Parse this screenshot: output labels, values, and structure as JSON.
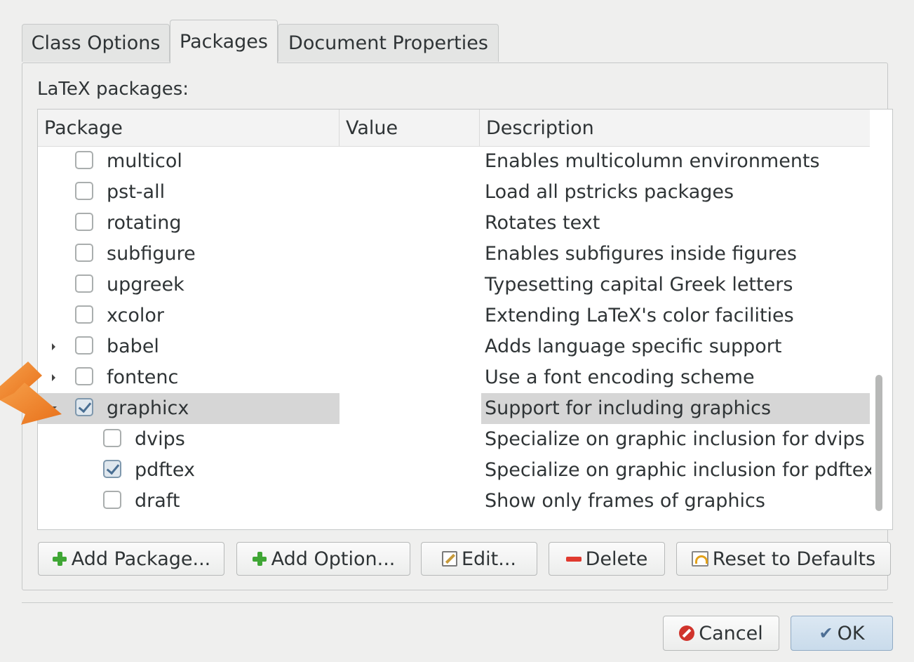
{
  "tabs": [
    {
      "label": "Class Options",
      "active": false
    },
    {
      "label": "Packages",
      "active": true
    },
    {
      "label": "Document Properties",
      "active": false
    }
  ],
  "section_label": "LaTeX packages:",
  "columns": [
    "Package",
    "Value",
    "Description"
  ],
  "rows": [
    {
      "name": "multicol",
      "value": "",
      "description": "Enables multicolumn environments",
      "checked": false,
      "level": 0,
      "expander": "none"
    },
    {
      "name": "pst-all",
      "value": "",
      "description": "Load all pstricks packages",
      "checked": false,
      "level": 0,
      "expander": "none"
    },
    {
      "name": "rotating",
      "value": "",
      "description": "Rotates text",
      "checked": false,
      "level": 0,
      "expander": "none"
    },
    {
      "name": "subfigure",
      "value": "",
      "description": "Enables subfigures inside figures",
      "checked": false,
      "level": 0,
      "expander": "none"
    },
    {
      "name": "upgreek",
      "value": "",
      "description": "Typesetting capital Greek letters",
      "checked": false,
      "level": 0,
      "expander": "none"
    },
    {
      "name": "xcolor",
      "value": "",
      "description": "Extending LaTeX's color facilities",
      "checked": false,
      "level": 0,
      "expander": "none"
    },
    {
      "name": "babel",
      "value": "",
      "description": "Adds language specific support",
      "checked": false,
      "level": 0,
      "expander": "collapsed"
    },
    {
      "name": "fontenc",
      "value": "",
      "description": "Use a font encoding scheme",
      "checked": false,
      "level": 0,
      "expander": "collapsed"
    },
    {
      "name": "graphicx",
      "value": "",
      "description": "Support for including graphics",
      "checked": true,
      "level": 0,
      "expander": "expanded",
      "selected": true
    },
    {
      "name": "dvips",
      "value": "",
      "description": "Specialize on graphic inclusion for dvips",
      "checked": false,
      "level": 1,
      "expander": "none"
    },
    {
      "name": "pdftex",
      "value": "",
      "description": "Specialize on graphic inclusion for pdftex",
      "checked": true,
      "level": 1,
      "expander": "none"
    },
    {
      "name": "draft",
      "value": "",
      "description": "Show only frames of graphics",
      "checked": false,
      "level": 1,
      "expander": "none"
    }
  ],
  "buttons": {
    "add_package": "Add Package...",
    "add_option": "Add Option...",
    "edit": "Edit...",
    "delete": "Delete",
    "reset": "Reset to Defaults",
    "cancel": "Cancel",
    "ok": "OK"
  },
  "colors": {
    "annotation_arrow": "#f07f1f",
    "selection": "#d6d6d6",
    "ok_button": "#c9dbeb"
  }
}
